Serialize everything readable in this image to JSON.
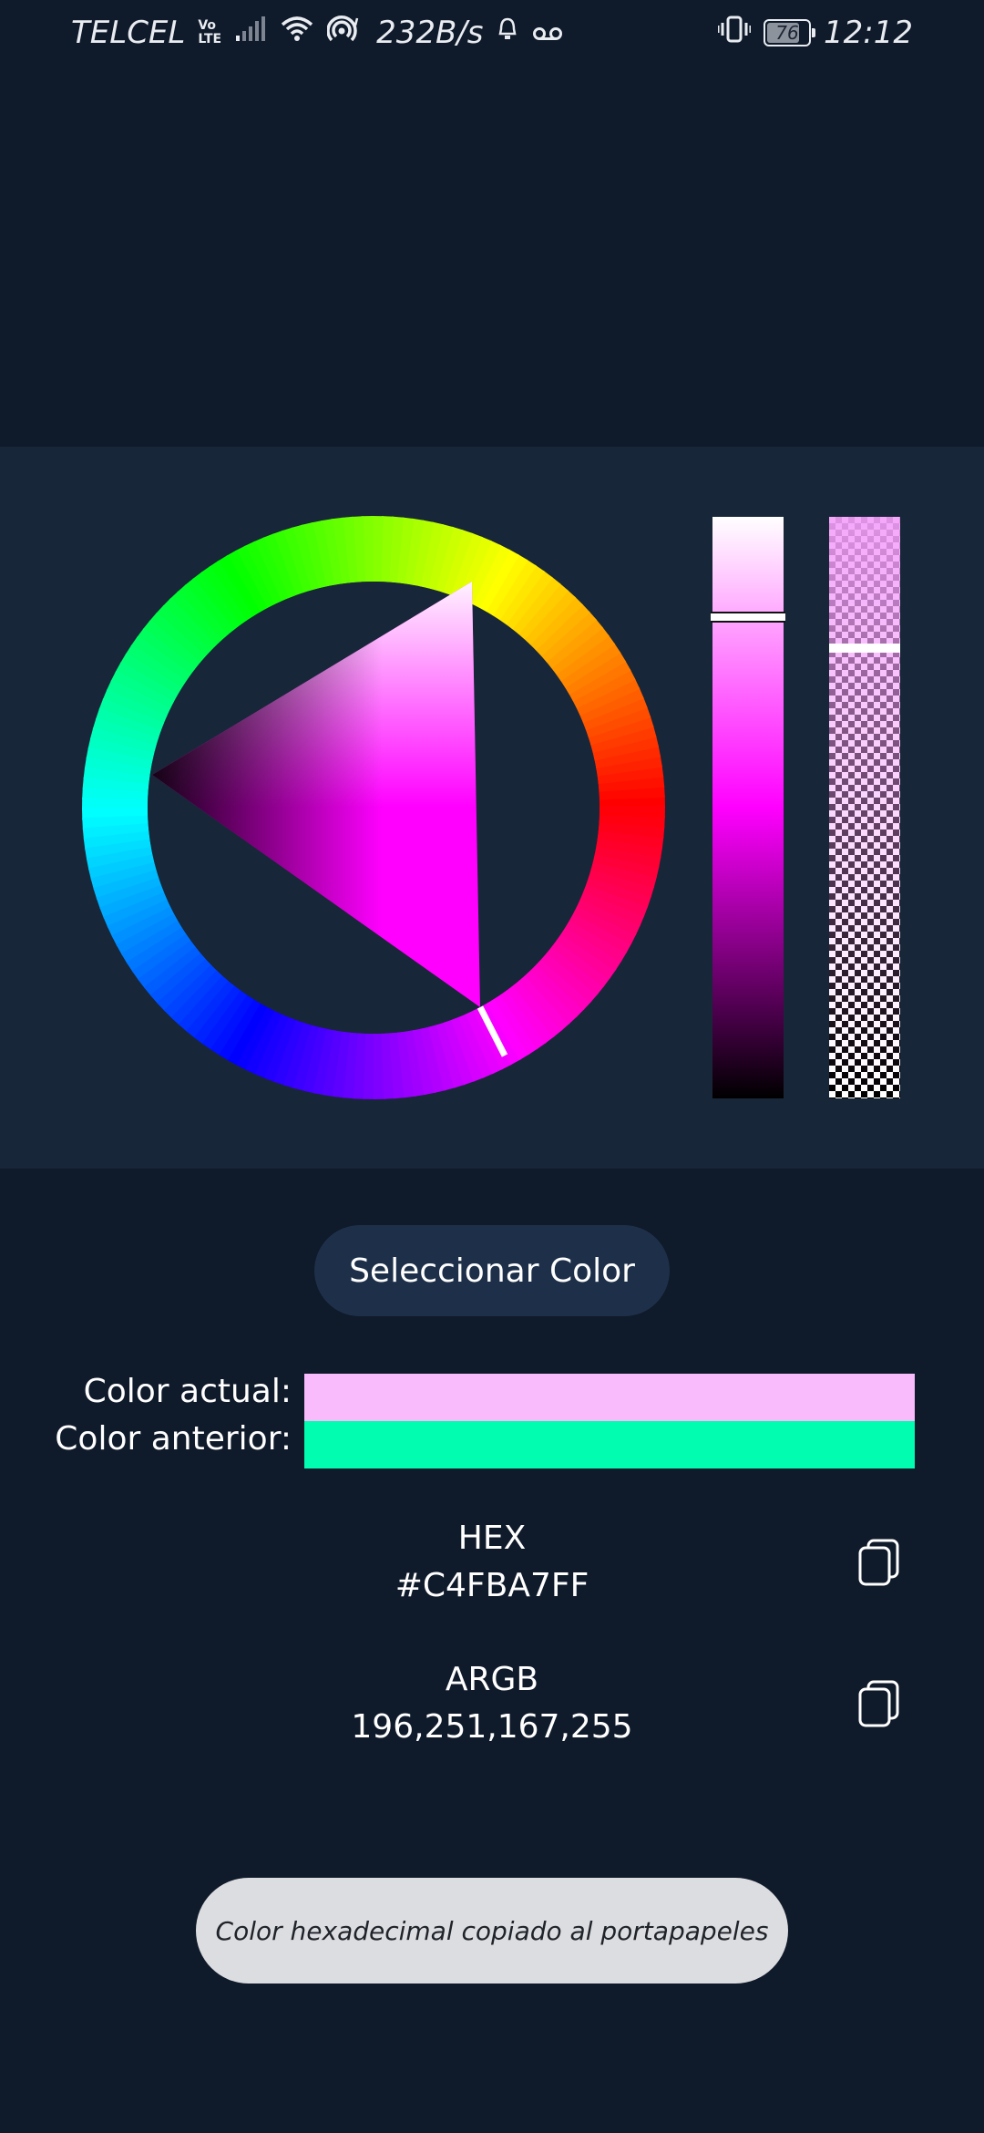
{
  "status_bar": {
    "carrier": "TELCEL",
    "volte_top": "Vo",
    "volte_bottom": "LTE",
    "net_speed": "232B/s",
    "battery": "76",
    "time": "12:12",
    "icons": [
      "signal-icon",
      "wifi-icon",
      "hotspot-icon",
      "notification-icon",
      "voicemail-icon",
      "vibrate-icon",
      "battery-icon"
    ]
  },
  "picker": {
    "hue_handle_color": "#ffffff",
    "value_bar_top": "#ffffff",
    "value_bar_mid": "#ff00ff",
    "value_bar_bottom": "#000000"
  },
  "select_button": {
    "label": "Seleccionar Color"
  },
  "colors": {
    "current_label": "Color actual:",
    "current_value": "#f9bbfb",
    "previous_label": "Color anterior:",
    "previous_value": "#00fdb0"
  },
  "hex": {
    "label": "HEX",
    "value": "#C4FBA7FF"
  },
  "argb": {
    "label": "ARGB",
    "value": "196,251,167,255"
  },
  "toast": {
    "message": "Color hexadecimal copiado al portapapeles"
  }
}
